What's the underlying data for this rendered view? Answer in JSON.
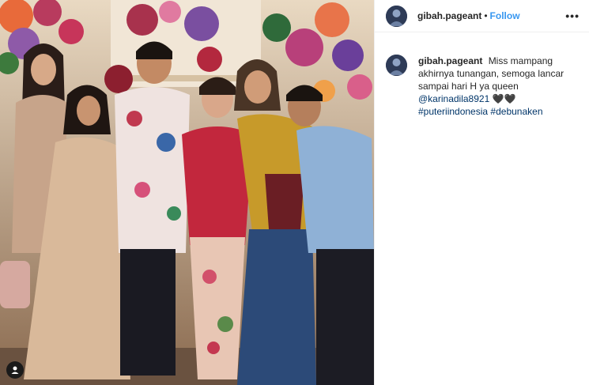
{
  "post": {
    "username": "gibah.pageant",
    "separator": "•",
    "follow_label": "Follow",
    "more_icon": "more-options-icon",
    "caption": {
      "username": "gibah.pageant",
      "text": "Miss mampang akhirnya tunangan, semoga lancar sampai hari H ya queen",
      "mention": "@karinadila8921",
      "emoji": "🖤🖤",
      "hashtags": [
        "#puteriindonesia",
        "#debunaken"
      ]
    },
    "photo_icon": "user-tag-icon"
  },
  "colors": {
    "follow": "#3897f0",
    "link": "#003569",
    "text": "#262626"
  }
}
